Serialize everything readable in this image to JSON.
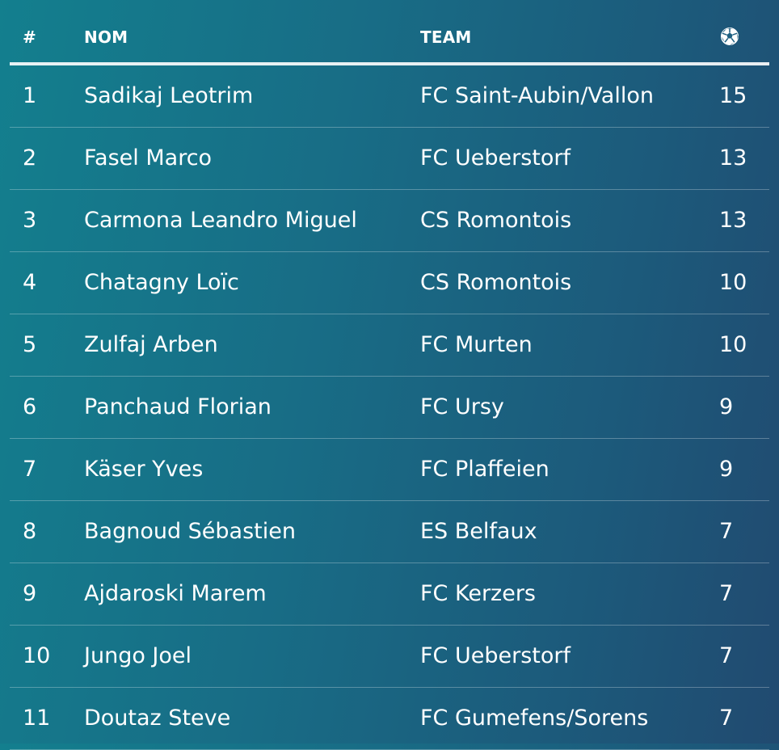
{
  "table": {
    "headers": {
      "rank": "#",
      "name": "NOM",
      "team": "TEAM",
      "goals_icon": "soccer-ball-icon"
    },
    "rows": [
      {
        "rank": "1",
        "name": "Sadikaj Leotrim",
        "team": "FC Saint-Aubin/Vallon",
        "goals": "15"
      },
      {
        "rank": "2",
        "name": "Fasel Marco",
        "team": "FC Ueberstorf",
        "goals": "13"
      },
      {
        "rank": "3",
        "name": "Carmona Leandro Miguel",
        "team": "CS Romontois",
        "goals": "13"
      },
      {
        "rank": "4",
        "name": "Chatagny Loïc",
        "team": "CS Romontois",
        "goals": "10"
      },
      {
        "rank": "5",
        "name": "Zulfaj Arben",
        "team": "FC Murten",
        "goals": "10"
      },
      {
        "rank": "6",
        "name": "Panchaud Florian",
        "team": "FC Ursy",
        "goals": "9"
      },
      {
        "rank": "7",
        "name": "Käser Yves",
        "team": "FC Plaffeien",
        "goals": "9"
      },
      {
        "rank": "8",
        "name": "Bagnoud Sébastien",
        "team": "ES Belfaux",
        "goals": "7"
      },
      {
        "rank": "9",
        "name": "Ajdaroski Marem",
        "team": "FC Kerzers",
        "goals": "7"
      },
      {
        "rank": "10",
        "name": "Jungo Joel",
        "team": "FC Ueberstorf",
        "goals": "7"
      },
      {
        "rank": "11",
        "name": "Doutaz Steve",
        "team": "FC Gumefens/Sorens",
        "goals": "7"
      }
    ]
  },
  "colors": {
    "background_start": "#137f8e",
    "background_end": "#214a70",
    "text": "#ffffff"
  }
}
